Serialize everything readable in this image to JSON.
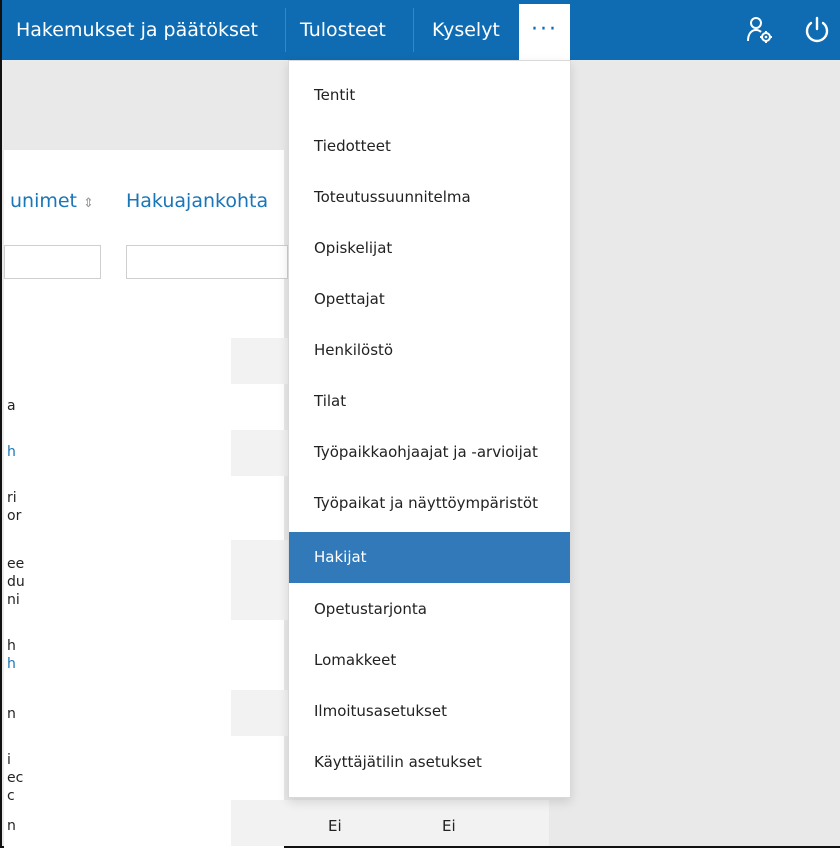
{
  "nav": {
    "items": [
      "Hakemukset ja päätökset",
      "Tulosteet",
      "Kyselyt"
    ],
    "more_label": "···",
    "user_icon": "user-settings-icon",
    "power_icon": "power-icon"
  },
  "table": {
    "columns": [
      {
        "label": "unimet",
        "sort_icon": "⇕"
      },
      {
        "label": "Hakuajankohta"
      }
    ],
    "row_fragments": [
      "a",
      "h",
      "ri",
      "or",
      "ee",
      "du",
      "ni",
      "h",
      "h",
      "n",
      "i",
      "ec",
      "c",
      "n"
    ],
    "bottom_row": [
      "Ei",
      "Ei"
    ]
  },
  "dropdown": {
    "items": [
      "Tentit",
      "Tiedotteet",
      "Toteutussuunnitelma",
      "Opiskelijat",
      "Opettajat",
      "Henkilöstö",
      "Tilat",
      "Työpaikkaohjaajat ja -arvioijat",
      "Työpaikat ja näyttöympäristöt",
      "Hakijat",
      "Opetustarjonta",
      "Lomakkeet",
      "Ilmoitusasetukset",
      "Käyttäjätilin asetukset"
    ],
    "active_item": "Hakijat"
  },
  "colors": {
    "brand": "#0f6cb2",
    "active": "#3179b9",
    "link": "#1976b8"
  }
}
